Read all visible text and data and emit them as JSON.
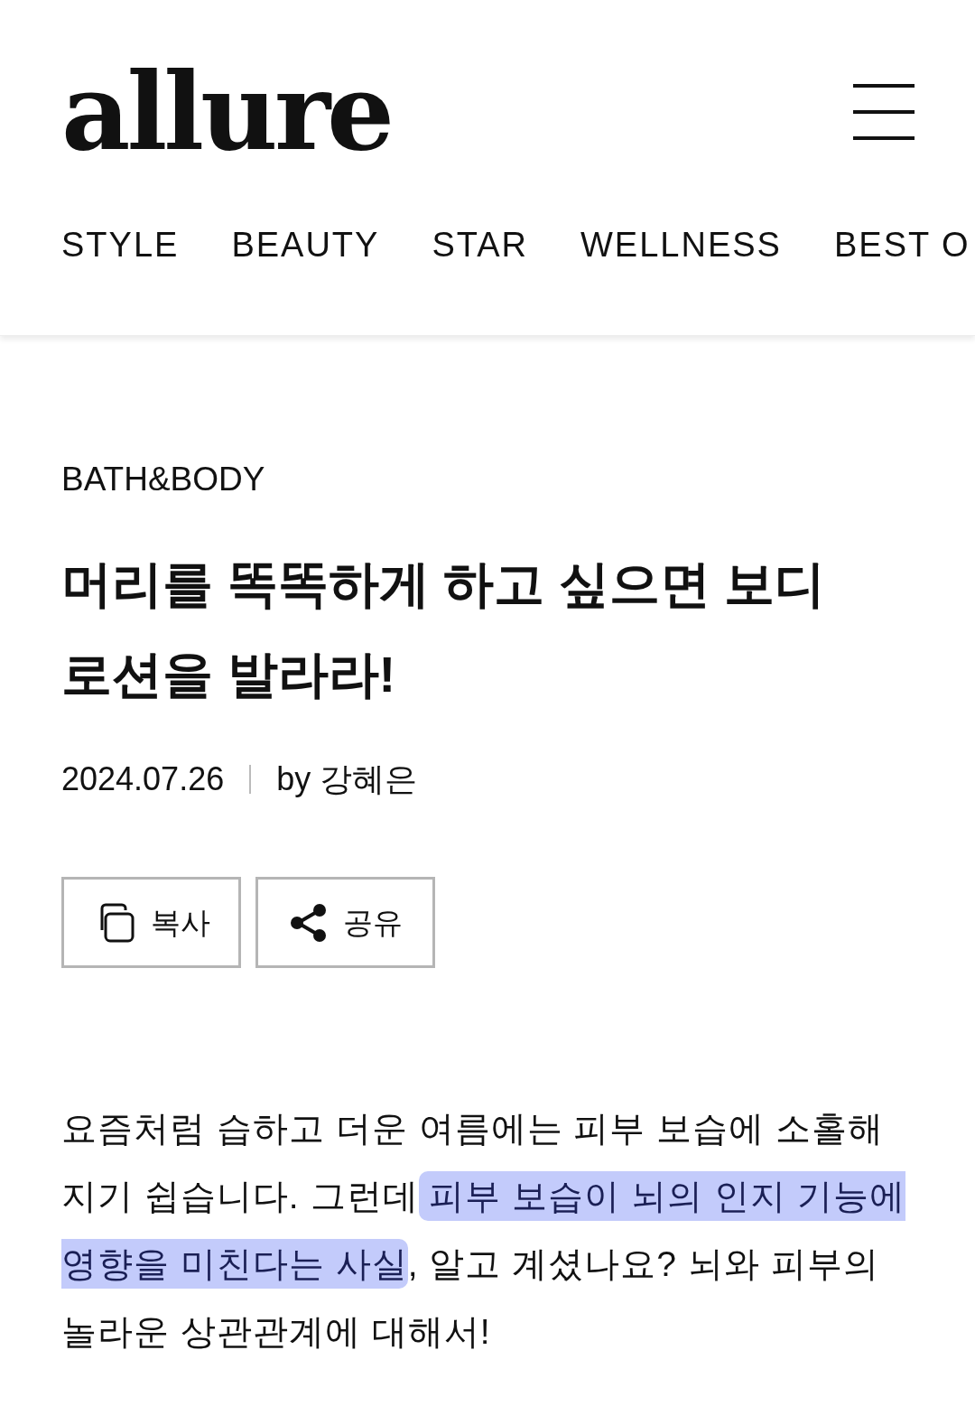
{
  "header": {
    "logo": "allure"
  },
  "nav": [
    {
      "label": "STYLE"
    },
    {
      "label": "BEAUTY"
    },
    {
      "label": "STAR"
    },
    {
      "label": "WELLNESS"
    },
    {
      "label": "BEST O"
    }
  ],
  "article": {
    "category": "BATH&BODY",
    "title": "머리를 똑똑하게 하고 싶으면 보디 로션을 발라라!",
    "date": "2024.07.26",
    "byline": "by 강혜은",
    "actions": [
      {
        "kind": "copy",
        "label": "복사"
      },
      {
        "kind": "share",
        "label": "공유"
      }
    ],
    "intro": [
      {
        "text": "요즘처럼 습하고 더운 여름에는 피부 보습에 소홀해지기 쉽습니다. 그런데",
        "highlighted": false
      },
      {
        "text": " 피부 보습이 뇌의 인지 기능에 영향을 미친다는 사실",
        "highlighted": true
      },
      {
        "text": ", 알고 계셨나요? 뇌와 피부의 놀라운 상관관계에 대해서!",
        "highlighted": false
      }
    ]
  }
}
